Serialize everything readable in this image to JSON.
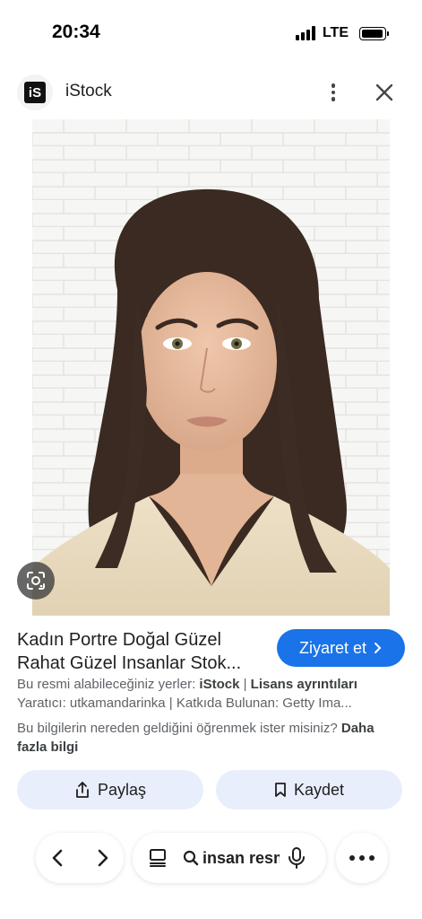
{
  "status": {
    "time": "20:34",
    "network": "LTE"
  },
  "header": {
    "site_name": "iStock",
    "logo_text": "iS"
  },
  "icons": {
    "more": "more-vert-icon",
    "close": "close-icon",
    "lens": "google-lens-icon",
    "share": "share-icon",
    "bookmark": "bookmark-icon",
    "back": "chevron-left-icon",
    "forward": "chevron-right-icon",
    "tabs": "tabs-icon",
    "search": "search-icon",
    "mic": "mic-icon",
    "menu": "more-horiz-icon"
  },
  "result": {
    "title_line1": "Kadın Portre Doğal Güzel",
    "title_line2": "Rahat Güzel Insanlar Stok...",
    "visit_label": "Ziyaret et",
    "available_prefix": "Bu resmi alabileceğiniz yerler: ",
    "available_source": "iStock",
    "available_sep": " | ",
    "license_label": "Lisans ayrıntıları",
    "credits": "Yaratıcı: utkamandarinka | Katkıda Bulunan: Getty Ima...",
    "info_question": "Bu bilgilerin nereden geldiğini öğrenmek ister misiniz? ",
    "learn_more_1": "Daha",
    "learn_more_2": "fazla bilgi"
  },
  "actions": {
    "share_label": "Paylaş",
    "save_label": "Kaydet"
  },
  "bottom": {
    "search_text": "insan resm"
  },
  "colors": {
    "accent": "#1a73e8",
    "action_bg": "#e8eefb"
  }
}
